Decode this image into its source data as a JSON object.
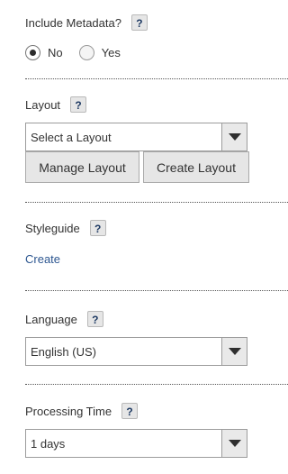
{
  "metadata": {
    "label": "Include Metadata?",
    "help": "?",
    "options": [
      {
        "label": "No",
        "checked": true
      },
      {
        "label": "Yes",
        "checked": false
      }
    ]
  },
  "layout": {
    "label": "Layout",
    "help": "?",
    "select_value": "Select a Layout",
    "manage_button": "Manage Layout",
    "create_button": "Create Layout"
  },
  "styleguide": {
    "label": "Styleguide",
    "help": "?",
    "create_link": "Create"
  },
  "language": {
    "label": "Language",
    "help": "?",
    "select_value": "English (US)"
  },
  "processing_time": {
    "label": "Processing Time",
    "help": "?",
    "select_value": "1 days"
  },
  "colors": {
    "link": "#2c5690",
    "help_text": "#1e3a63",
    "button_bg": "#e6e6e6"
  }
}
